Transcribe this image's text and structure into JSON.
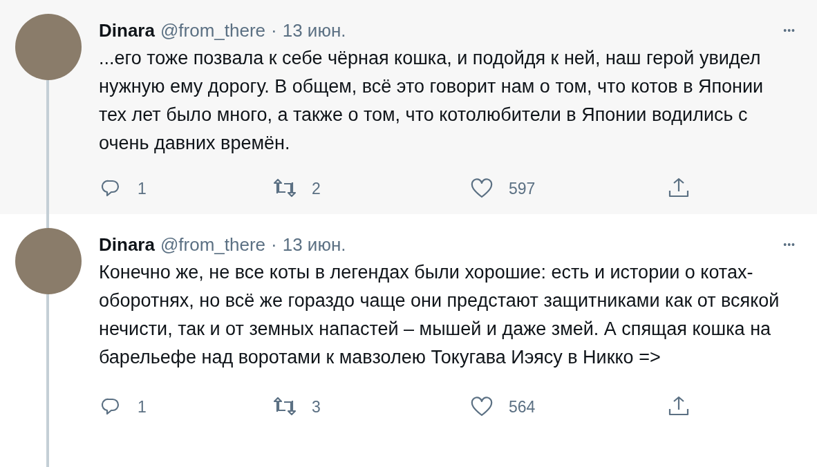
{
  "tweets": [
    {
      "color": "#f7f7f7",
      "name": "Dinara",
      "handle": "@from_there",
      "separator": "·",
      "date": "13 июн.",
      "more": "•••",
      "text": "...его тоже позвала к себе чёрная кошка, и подойдя к ней, наш герой увидел нужную ему дорогу. В общем, всё это говорит нам о том, что котов в Японии тех лет было много, а также о том, что котолюбители в Японии водились с очень давних времён.",
      "replies": "1",
      "retweets": "2",
      "likes": "597"
    },
    {
      "color": "#ffffff",
      "name": "Dinara",
      "handle": "@from_there",
      "separator": "·",
      "date": "13 июн.",
      "more": "•••",
      "text": "Конечно же, не все коты в легендах были хорошие: есть и истории о котах-оборотнях, но всё же гораздо чаще они предстают защитниками как от всякой нечисти, так и от земных напастей – мышей и даже змей. А спящая кошка на барельефе над воротами к мавзолею Токугава Иэясу в Никко =>",
      "replies": "1",
      "retweets": "3",
      "likes": "564"
    }
  ]
}
